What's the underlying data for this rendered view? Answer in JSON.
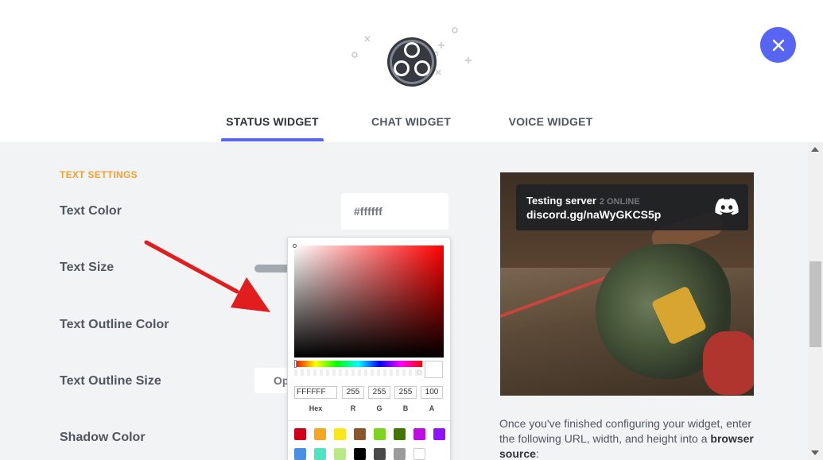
{
  "tabs": [
    {
      "label": "STATUS WIDGET",
      "active": true
    },
    {
      "label": "CHAT WIDGET",
      "active": false
    },
    {
      "label": "VOICE WIDGET",
      "active": false
    }
  ],
  "header": {
    "logo_icon": "obs-logo-icon",
    "close_icon": "close-icon"
  },
  "settings": {
    "section_title": "TEXT SETTINGS",
    "text_color_label": "Text Color",
    "text_color_value": "#ffffff",
    "text_size_label": "Text Size",
    "text_outline_color_label": "Text Outline Color",
    "text_outline_size_label": "Text Outline Size",
    "text_outline_size_button": "Op",
    "shadow_color_label": "Shadow Color"
  },
  "color_picker": {
    "hex": "FFFFFF",
    "r": "255",
    "g": "255",
    "b": "255",
    "a": "100",
    "alpha_marker": "0",
    "labels": {
      "hex": "Hex",
      "r": "R",
      "g": "G",
      "b": "B",
      "a": "A"
    },
    "swatches": [
      "#d0021b",
      "#f5a623",
      "#f8e71c",
      "#8b572a",
      "#7ed321",
      "#417505",
      "#bd10e0",
      "#9013fe",
      "#4a90e2",
      "#50e3c2",
      "#b8e986",
      "#000000",
      "#4a4a4a",
      "#9b9b9b",
      "#ffffff"
    ]
  },
  "preview": {
    "server_name": "Testing server",
    "online": "2 ONLINE",
    "invite": "discord.gg/naWyGKCS5p",
    "icon": "discord-icon"
  },
  "help": {
    "text_before": "Once you've finished configuring your widget, enter the following URL, width, and height into a",
    "bold": "browser source",
    "text_after": ":"
  },
  "colors": {
    "accent": "#5865f2",
    "section": "#f0a232"
  }
}
